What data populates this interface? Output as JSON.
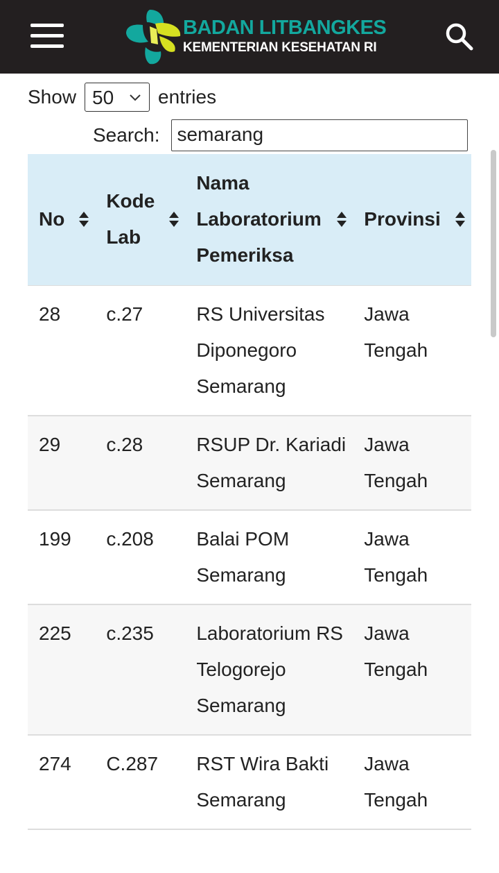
{
  "header": {
    "logo_title": "BADAN LITBANGKES",
    "logo_subtitle": "KEMENTERIAN KESEHATAN RI",
    "colors": {
      "background": "#231f20",
      "logo_teal": "#13a89e",
      "logo_yellow": "#d6e021"
    }
  },
  "controls": {
    "show_label": "Show",
    "entries_value": "50",
    "entries_label": "entries",
    "search_label": "Search:",
    "search_value": "semarang"
  },
  "table": {
    "columns": [
      "No",
      "Kode Lab",
      "Nama Laboratorium Pemeriksa",
      "Provinsi"
    ],
    "rows": [
      {
        "no": "28",
        "kode": "c.27",
        "nama": "RS Universitas Diponegoro Semarang",
        "provinsi": "Jawa Tengah"
      },
      {
        "no": "29",
        "kode": "c.28",
        "nama": "RSUP Dr. Kariadi Semarang",
        "provinsi": "Jawa Tengah"
      },
      {
        "no": "199",
        "kode": "c.208",
        "nama": "Balai POM Semarang",
        "provinsi": "Jawa Tengah"
      },
      {
        "no": "225",
        "kode": "c.235",
        "nama": "Laboratorium RS Telogorejo Semarang",
        "provinsi": "Jawa Tengah"
      },
      {
        "no": "274",
        "kode": "C.287",
        "nama": "RST Wira Bakti Semarang",
        "provinsi": "Jawa Tengah"
      }
    ],
    "colors": {
      "header_bg": "#d9edf7",
      "stripe": "#f7f7f7"
    }
  }
}
